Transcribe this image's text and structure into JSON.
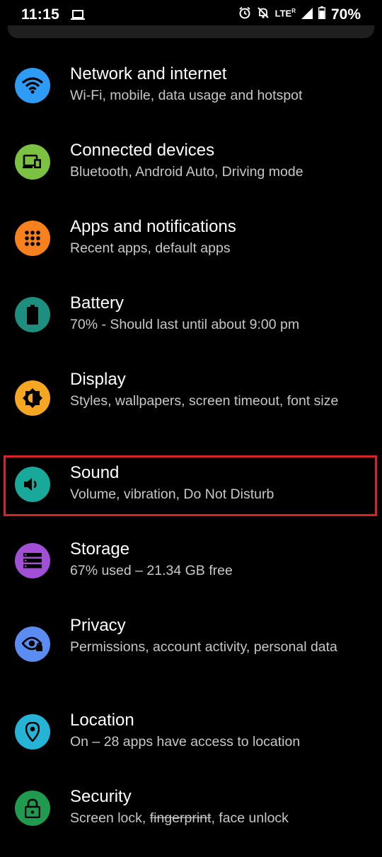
{
  "status_bar": {
    "time": "11:15",
    "network": "LTE",
    "network_sup": "R",
    "battery_percent": "70%"
  },
  "settings": [
    {
      "id": "network",
      "title": "Network and internet",
      "subtitle": "Wi-Fi, mobile, data usage and hotspot",
      "icon": "wifi-icon",
      "color": "#2e9cf4"
    },
    {
      "id": "connected-devices",
      "title": "Connected devices",
      "subtitle": "Bluetooth, Android Auto, Driving mode",
      "icon": "connected-devices-icon",
      "color": "#7bc142"
    },
    {
      "id": "apps",
      "title": "Apps and notifications",
      "subtitle": "Recent apps, default apps",
      "icon": "apps-grid-icon",
      "color": "#f7821d"
    },
    {
      "id": "battery",
      "title": "Battery",
      "subtitle": "70% - Should last until about 9:00 pm",
      "icon": "battery-icon",
      "color": "#1d8f7f"
    },
    {
      "id": "display",
      "title": "Display",
      "subtitle": "Styles, wallpapers, screen timeout, font size",
      "icon": "brightness-icon",
      "color": "#f5a623"
    },
    {
      "id": "sound",
      "title": "Sound",
      "subtitle": "Volume, vibration, Do Not Disturb",
      "icon": "speaker-icon",
      "color": "#19a99a"
    },
    {
      "id": "storage",
      "title": "Storage",
      "subtitle": "67% used – 21.34 GB free",
      "icon": "storage-icon",
      "color": "#a04fd6"
    },
    {
      "id": "privacy",
      "title": "Privacy",
      "subtitle_parts": [
        "Permissions, account activity, personal data"
      ],
      "subtitle": "Permissions, account activity, personal data",
      "icon": "privacy-eye-icon",
      "color": "#5b8cf1"
    },
    {
      "id": "location",
      "title": "Location",
      "subtitle": "On – 28 apps have access to location",
      "icon": "location-pin-icon",
      "color": "#25b4d6"
    },
    {
      "id": "security",
      "title": "Security",
      "subtitle_a": "Screen lock, ",
      "subtitle_strike": "fingerprint",
      "subtitle_b": ", face unlock",
      "icon": "lock-icon",
      "color": "#1f9a4f"
    }
  ],
  "highlighted": "Sound"
}
